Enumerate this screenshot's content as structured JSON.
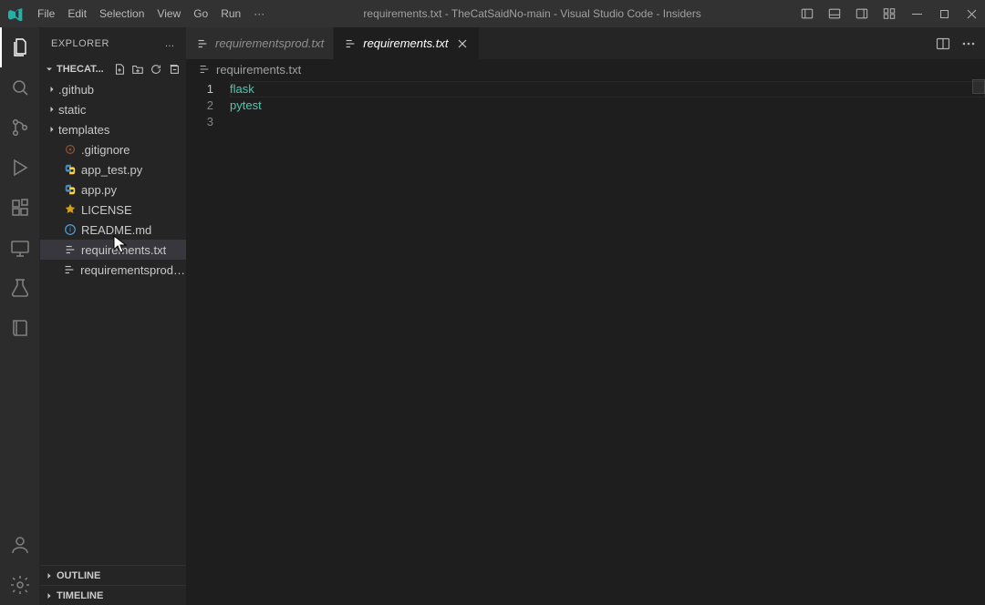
{
  "titlebar": {
    "menu": [
      "File",
      "Edit",
      "Selection",
      "View",
      "Go",
      "Run",
      "···"
    ],
    "title": "requirements.txt - TheCatSaidNo-main - Visual Studio Code - Insiders"
  },
  "activitybar": {
    "items": [
      {
        "name": "explorer",
        "active": true
      },
      {
        "name": "search",
        "active": false
      },
      {
        "name": "source-control",
        "active": false
      },
      {
        "name": "run-debug",
        "active": false
      },
      {
        "name": "extensions",
        "active": false
      },
      {
        "name": "remote",
        "active": false
      },
      {
        "name": "flask",
        "active": false
      },
      {
        "name": "book",
        "active": false
      }
    ],
    "bottom": [
      "account",
      "settings"
    ]
  },
  "sidebar": {
    "title": "EXPLORER",
    "root_label": "THECAT...",
    "tree": [
      {
        "kind": "folder",
        "label": ".github"
      },
      {
        "kind": "folder",
        "label": "static"
      },
      {
        "kind": "folder",
        "label": "templates"
      },
      {
        "kind": "file",
        "label": ".gitignore",
        "ftype": "git"
      },
      {
        "kind": "file",
        "label": "app_test.py",
        "ftype": "py"
      },
      {
        "kind": "file",
        "label": "app.py",
        "ftype": "py"
      },
      {
        "kind": "file",
        "label": "LICENSE",
        "ftype": "lic"
      },
      {
        "kind": "file",
        "label": "README.md",
        "ftype": "info"
      },
      {
        "kind": "file",
        "label": "requirements.txt",
        "ftype": "txt",
        "selected": true
      },
      {
        "kind": "file",
        "label": "requirementsprod.txt",
        "ftype": "txt"
      }
    ],
    "panels": [
      "OUTLINE",
      "TIMELINE"
    ]
  },
  "tabs": [
    {
      "label": "requirementsprod.txt",
      "active": false,
      "ftype": "txt"
    },
    {
      "label": "requirements.txt",
      "active": true,
      "ftype": "txt"
    }
  ],
  "breadcrumb": {
    "label": "requirements.txt"
  },
  "editor": {
    "lines": [
      "flask",
      "pytest",
      ""
    ],
    "current_line": 1
  }
}
